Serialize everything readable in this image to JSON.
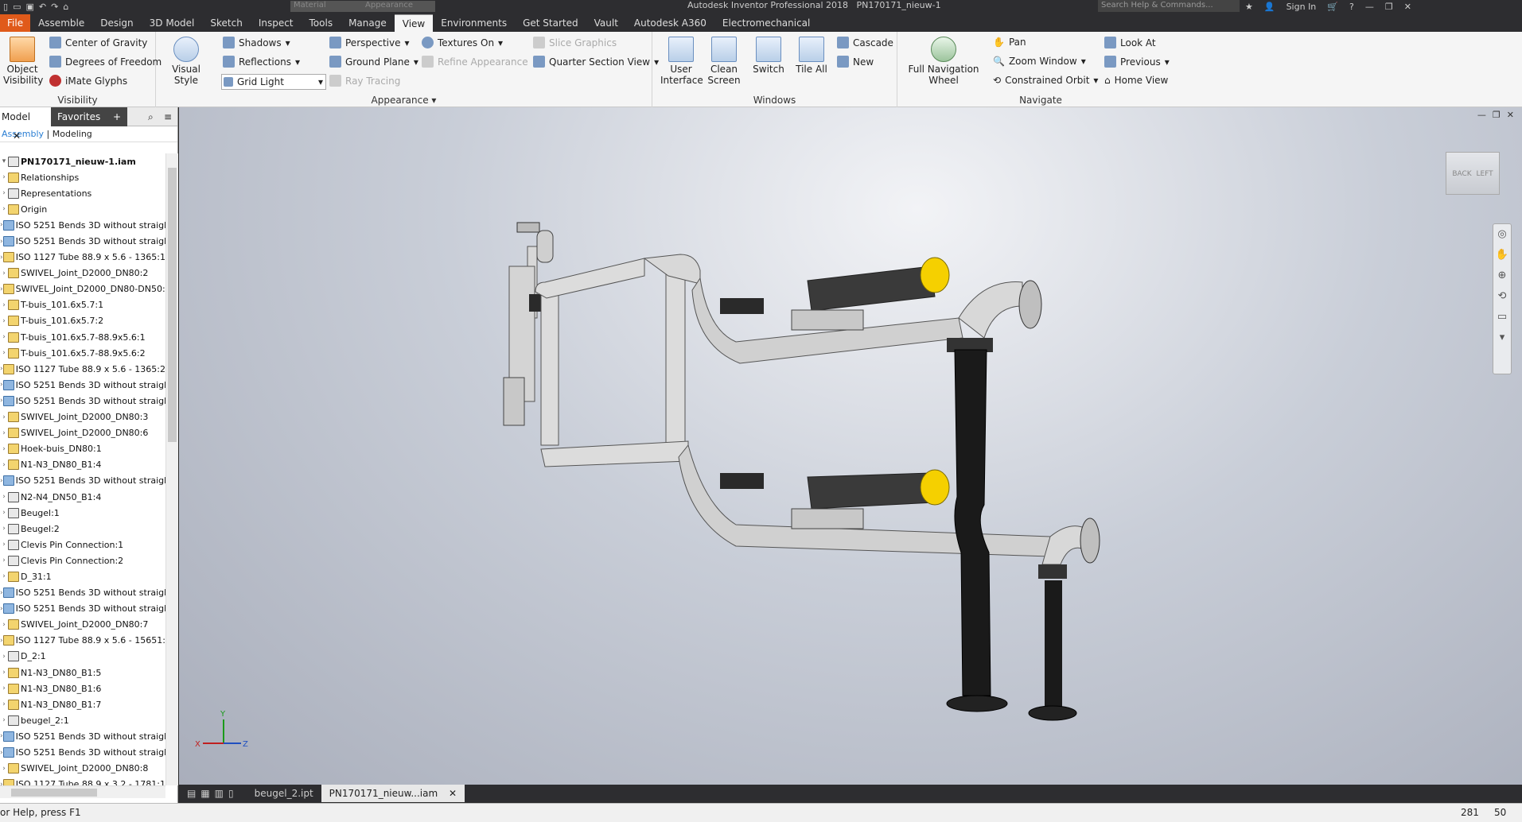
{
  "title": {
    "app": "Autodesk Inventor Professional 2018",
    "document": "PN170171_nieuw-1",
    "material_placeholder": "Material",
    "appearance_placeholder": "Appearance",
    "search": "Search Help & Commands...",
    "sign_in": "Sign In"
  },
  "tabs": [
    {
      "label": "File"
    },
    {
      "label": "Assemble"
    },
    {
      "label": "Design"
    },
    {
      "label": "3D Model"
    },
    {
      "label": "Sketch"
    },
    {
      "label": "Inspect"
    },
    {
      "label": "Tools"
    },
    {
      "label": "Manage"
    },
    {
      "label": "View"
    },
    {
      "label": "Environments"
    },
    {
      "label": "Get Started"
    },
    {
      "label": "Vault"
    },
    {
      "label": "Autodesk A360"
    },
    {
      "label": "Electromechanical"
    }
  ],
  "ribbon": {
    "visibility": {
      "name": "Visibility",
      "object_visibility": "Object Visibility",
      "center_of_gravity": "Center of Gravity",
      "degrees_of_freedom": "Degrees of Freedom",
      "imate_glyphs": "iMate Glyphs"
    },
    "appearance": {
      "name": "Appearance",
      "visual_style": "Visual Style",
      "shadows": "Shadows",
      "reflections": "Reflections",
      "lighting": "Grid Light",
      "perspective": "Perspective",
      "ground_plane": "Ground Plane",
      "ray_tracing": "Ray Tracing",
      "textures": "Textures On",
      "refine": "Refine Appearance",
      "slice": "Slice Graphics",
      "quarter": "Quarter Section View"
    },
    "windows": {
      "name": "Windows",
      "user_interface": "User Interface",
      "clean_screen": "Clean Screen",
      "switch": "Switch",
      "tile_all": "Tile All",
      "cascade": "Cascade",
      "new": "New"
    },
    "navigate": {
      "name": "Navigate",
      "nav_wheel": "Full Navigation Wheel",
      "pan": "Pan",
      "zoom_window": "Zoom Window",
      "constrained_orbit": "Constrained Orbit",
      "look_at": "Look At",
      "previous": "Previous",
      "home_view": "Home View"
    }
  },
  "browser": {
    "tab_model": "Model",
    "tab_favorites": "Favorites",
    "assembly": "Assembly",
    "modeling": "Modeling",
    "items": [
      {
        "label": "PN170171_nieuw-1.iam",
        "icon": "c"
      },
      {
        "label": "Relationships",
        "icon": "f"
      },
      {
        "label": "Representations",
        "icon": "c"
      },
      {
        "label": "Origin",
        "icon": "f"
      },
      {
        "label": "ISO 5251 Bends 3D without straight",
        "icon": "b"
      },
      {
        "label": "ISO 5251 Bends 3D without straight",
        "icon": "b"
      },
      {
        "label": "ISO 1127 Tube 88.9 x 5.6 - 1365:1",
        "icon": "f"
      },
      {
        "label": "SWIVEL_Joint_D2000_DN80:2",
        "icon": "f"
      },
      {
        "label": "SWIVEL_Joint_D2000_DN80-DN50:1",
        "icon": "f"
      },
      {
        "label": "T-buis_101.6x5.7:1",
        "icon": "f"
      },
      {
        "label": "T-buis_101.6x5.7:2",
        "icon": "f"
      },
      {
        "label": "T-buis_101.6x5.7-88.9x5.6:1",
        "icon": "f"
      },
      {
        "label": "T-buis_101.6x5.7-88.9x5.6:2",
        "icon": "f"
      },
      {
        "label": "ISO 1127 Tube 88.9 x 5.6 - 1365:2",
        "icon": "f"
      },
      {
        "label": "ISO 5251 Bends 3D without straight",
        "icon": "b"
      },
      {
        "label": "ISO 5251 Bends 3D without straight",
        "icon": "b"
      },
      {
        "label": "SWIVEL_Joint_D2000_DN80:3",
        "icon": "f"
      },
      {
        "label": "SWIVEL_Joint_D2000_DN80:6",
        "icon": "f"
      },
      {
        "label": "Hoek-buis_DN80:1",
        "icon": "f"
      },
      {
        "label": "N1-N3_DN80_B1:4",
        "icon": "f"
      },
      {
        "label": "ISO 5251 Bends 3D without straight",
        "icon": "b"
      },
      {
        "label": "N2-N4_DN50_B1:4",
        "icon": "c"
      },
      {
        "label": "Beugel:1",
        "icon": "c"
      },
      {
        "label": "Beugel:2",
        "icon": "c"
      },
      {
        "label": "Clevis Pin Connection:1",
        "icon": "c"
      },
      {
        "label": "Clevis Pin Connection:2",
        "icon": "c"
      },
      {
        "label": "D_31:1",
        "icon": "f"
      },
      {
        "label": "ISO 5251 Bends 3D without straight",
        "icon": "b"
      },
      {
        "label": "ISO 5251 Bends 3D without straight",
        "icon": "b"
      },
      {
        "label": "SWIVEL_Joint_D2000_DN80:7",
        "icon": "f"
      },
      {
        "label": "ISO 1127 Tube 88.9 x 5.6 - 15651:1",
        "icon": "f"
      },
      {
        "label": "D_2:1",
        "icon": "c"
      },
      {
        "label": "N1-N3_DN80_B1:5",
        "icon": "f"
      },
      {
        "label": "N1-N3_DN80_B1:6",
        "icon": "f"
      },
      {
        "label": "N1-N3_DN80_B1:7",
        "icon": "f"
      },
      {
        "label": "beugel_2:1",
        "icon": "c"
      },
      {
        "label": "ISO 5251 Bends 3D without straight",
        "icon": "b"
      },
      {
        "label": "ISO 5251 Bends 3D without straight",
        "icon": "b"
      },
      {
        "label": "SWIVEL_Joint_D2000_DN80:8",
        "icon": "f"
      },
      {
        "label": "ISO 1127 Tube 88.9 x 3.2 - 1781:1",
        "icon": "f"
      }
    ]
  },
  "viewcube": {
    "back": "BACK",
    "left": "LEFT"
  },
  "axes": {
    "x": "X",
    "y": "Y",
    "z": "Z"
  },
  "doc_tabs": [
    {
      "label": "beugel_2.ipt"
    },
    {
      "label": "PN170171_nieuw...iam"
    }
  ],
  "status": {
    "help": "or Help, press F1",
    "a": "281",
    "b": "50"
  }
}
